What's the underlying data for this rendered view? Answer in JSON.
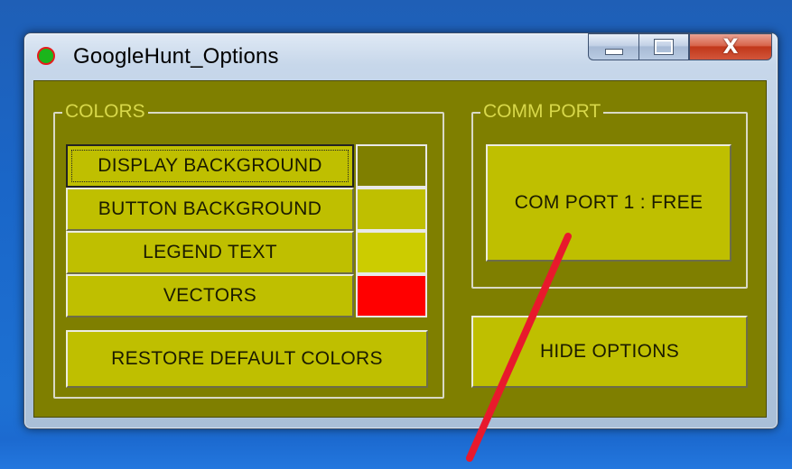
{
  "window": {
    "title": "GoogleHunt_Options",
    "controls": {
      "minimize": "–",
      "maximize": "□",
      "close": "X"
    }
  },
  "colors_group": {
    "label": "COLORS",
    "items": [
      {
        "label": "DISPLAY BACKGROUND",
        "swatch_color": "#7f7f00",
        "focused": true
      },
      {
        "label": "BUTTON BACKGROUND",
        "swatch_color": "#bfbf00",
        "focused": false
      },
      {
        "label": "LEGEND TEXT",
        "swatch_color": "#cccc00",
        "focused": false
      },
      {
        "label": "VECTORS",
        "swatch_color": "#ff0000",
        "focused": false
      }
    ],
    "restore_button": "RESTORE DEFAULT COLORS"
  },
  "comm_group": {
    "label": "COMM PORT",
    "port_button": "COM PORT 1 : FREE"
  },
  "hide_options_button": "HIDE OPTIONS",
  "theme": {
    "display_background": "#7f7f00",
    "button_background": "#bfbf00",
    "legend_text": "#d8d84a",
    "vector_color": "#e8192c"
  }
}
